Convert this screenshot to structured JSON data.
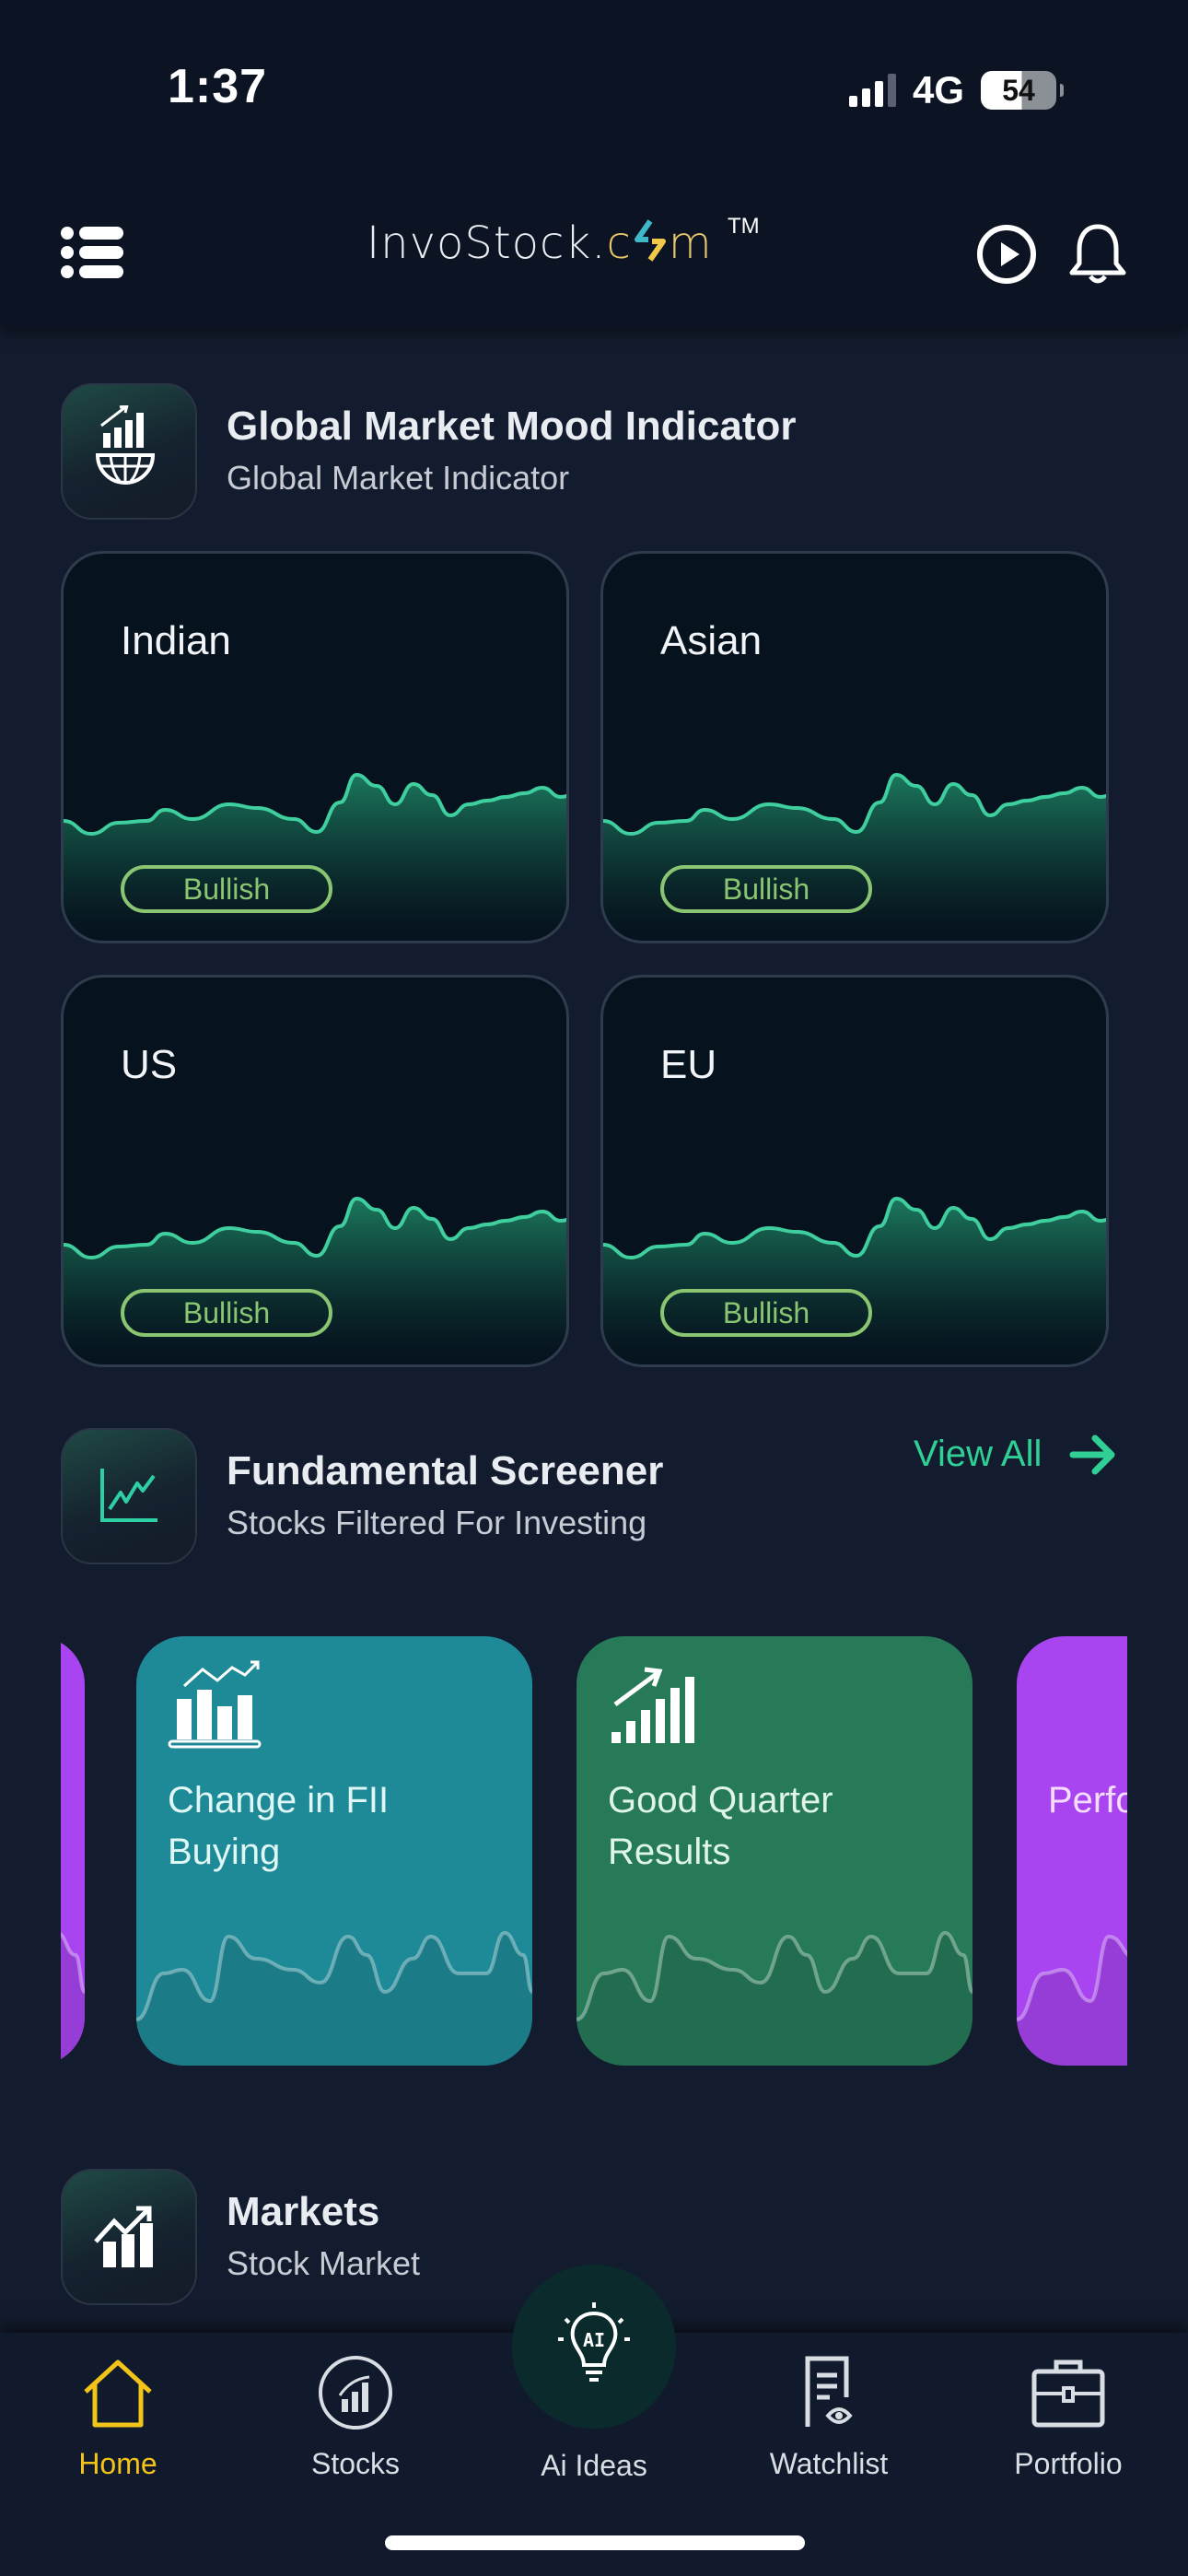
{
  "status_bar": {
    "time": "1:37",
    "network": "4G",
    "battery": "54"
  },
  "header": {
    "logo_text_main": "InvoStock.",
    "logo_text_c": "c",
    "logo_text_m": "m",
    "trademark": "TM",
    "menu_icon": "menu-list-icon",
    "play_icon": "play-circle-icon",
    "bell_icon": "bell-icon"
  },
  "mood_section": {
    "title": "Global Market Mood Indicator",
    "subtitle": "Global Market Indicator",
    "icon": "globe-chart-icon",
    "cards": [
      {
        "label": "Indian",
        "status": "Bullish"
      },
      {
        "label": "Asian",
        "status": "Bullish"
      },
      {
        "label": "US",
        "status": "Bullish"
      },
      {
        "label": "EU",
        "status": "Bullish"
      }
    ]
  },
  "screener_section": {
    "title": "Fundamental Screener",
    "subtitle": "Stocks Filtered For Investing",
    "icon": "line-chart-icon",
    "view_all": "View All",
    "cards": [
      {
        "title": "",
        "color": "#a945f0"
      },
      {
        "title": "Change in FII Buying",
        "color": "#1f8a97",
        "icon": "bar-chart-trend-icon"
      },
      {
        "title": "Good Quarter Results",
        "color": "#267a58",
        "icon": "signal-growth-icon"
      },
      {
        "title": "Perfo",
        "color": "#a945f0"
      }
    ]
  },
  "markets_section": {
    "title": "Markets",
    "subtitle": "Stock Market",
    "icon": "bar-chart-arrow-icon"
  },
  "bottom_nav": {
    "items": [
      {
        "label": "Home",
        "icon": "home-icon",
        "active": true
      },
      {
        "label": "Stocks",
        "icon": "stocks-icon",
        "active": false
      },
      {
        "label": "Ai Ideas",
        "icon": "ai-bulb-icon",
        "active": false
      },
      {
        "label": "Watchlist",
        "icon": "watchlist-icon",
        "active": false
      },
      {
        "label": "Portfolio",
        "icon": "briefcase-icon",
        "active": false
      }
    ]
  },
  "colors": {
    "accent_green": "#2fcf95",
    "bullish": "#8ac671",
    "active_nav": "#f2c319",
    "background": "#131c2e"
  }
}
